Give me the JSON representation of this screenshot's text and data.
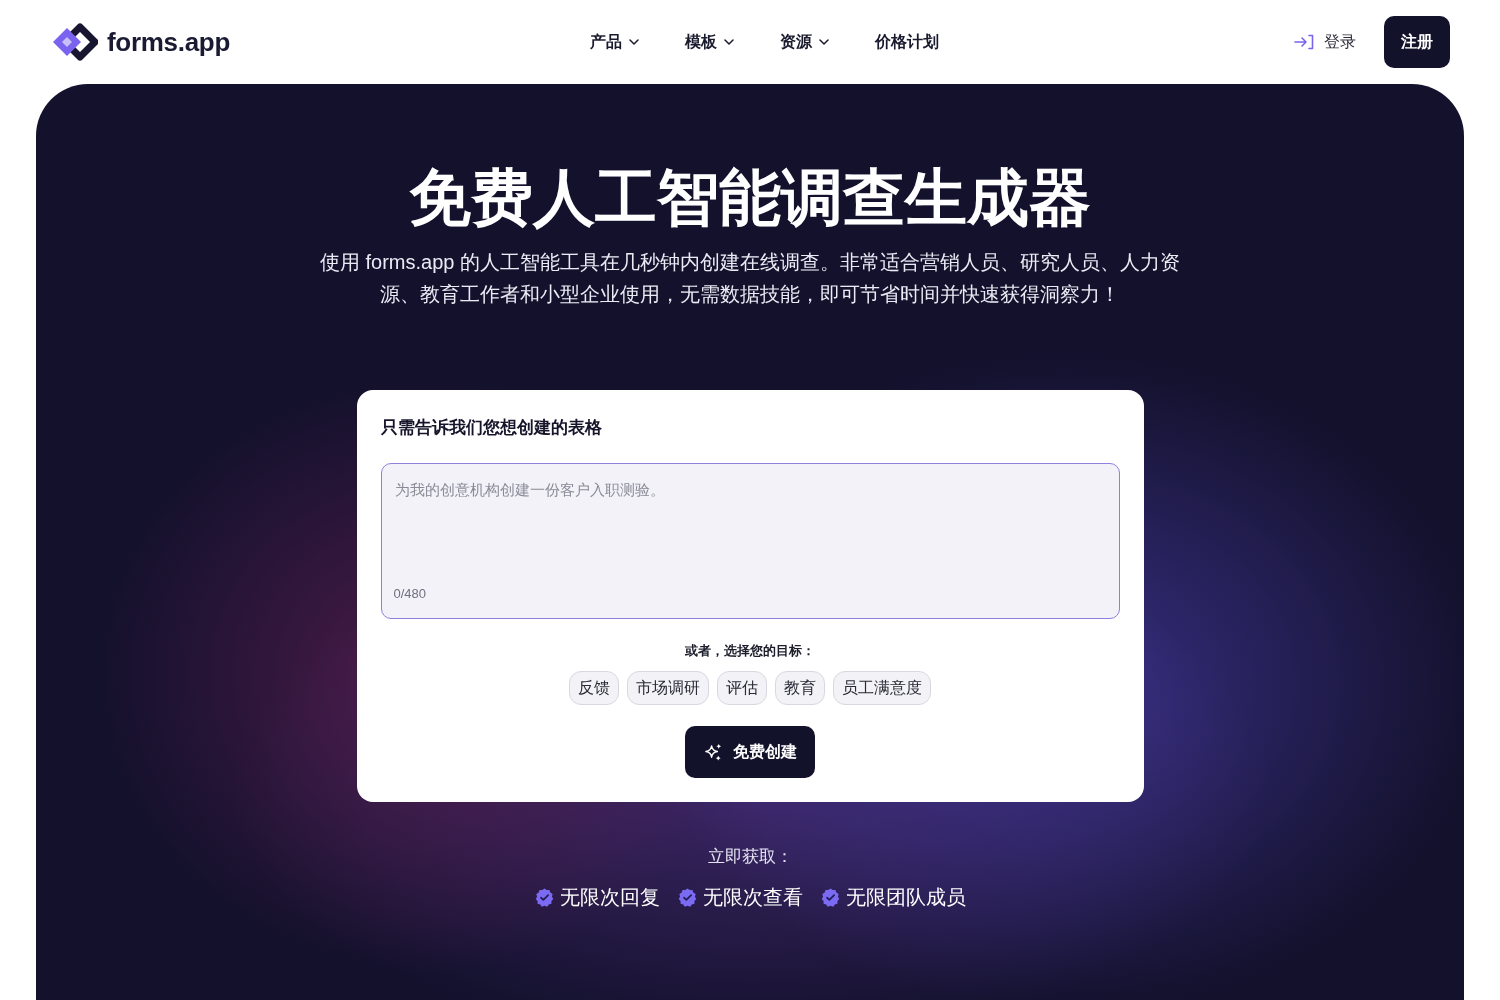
{
  "header": {
    "logo": {
      "text": "forms.app"
    },
    "nav": [
      {
        "label": "产品",
        "dropdown": true
      },
      {
        "label": "模板",
        "dropdown": true
      },
      {
        "label": "资源",
        "dropdown": true
      },
      {
        "label": "价格计划",
        "dropdown": false
      }
    ],
    "login": {
      "label": "登录"
    },
    "signup": {
      "label": "注册"
    }
  },
  "hero": {
    "title": "免费人工智能调查生成器",
    "subtitle": "使用 forms.app 的人工智能工具在几秒钟内创建在线调查。非常适合营销人员、研究人员、人力资源、教育工作者和小型企业使用，无需数据技能，即可节省时间并快速获得洞察力！"
  },
  "card": {
    "heading": "只需告诉我们您想创建的表格",
    "prompt": {
      "placeholder": "为我的创意机构创建一份客户入职测验。",
      "counter": "0/480"
    },
    "goals_label": "或者，选择您的目标：",
    "goals": [
      "反馈",
      "市场调研",
      "评估",
      "教育",
      "员工满意度"
    ],
    "create_button": "免费创建"
  },
  "benefits": {
    "label": "立即获取：",
    "items": [
      "无限次回复",
      "无限次查看",
      "无限团队成员"
    ]
  }
}
